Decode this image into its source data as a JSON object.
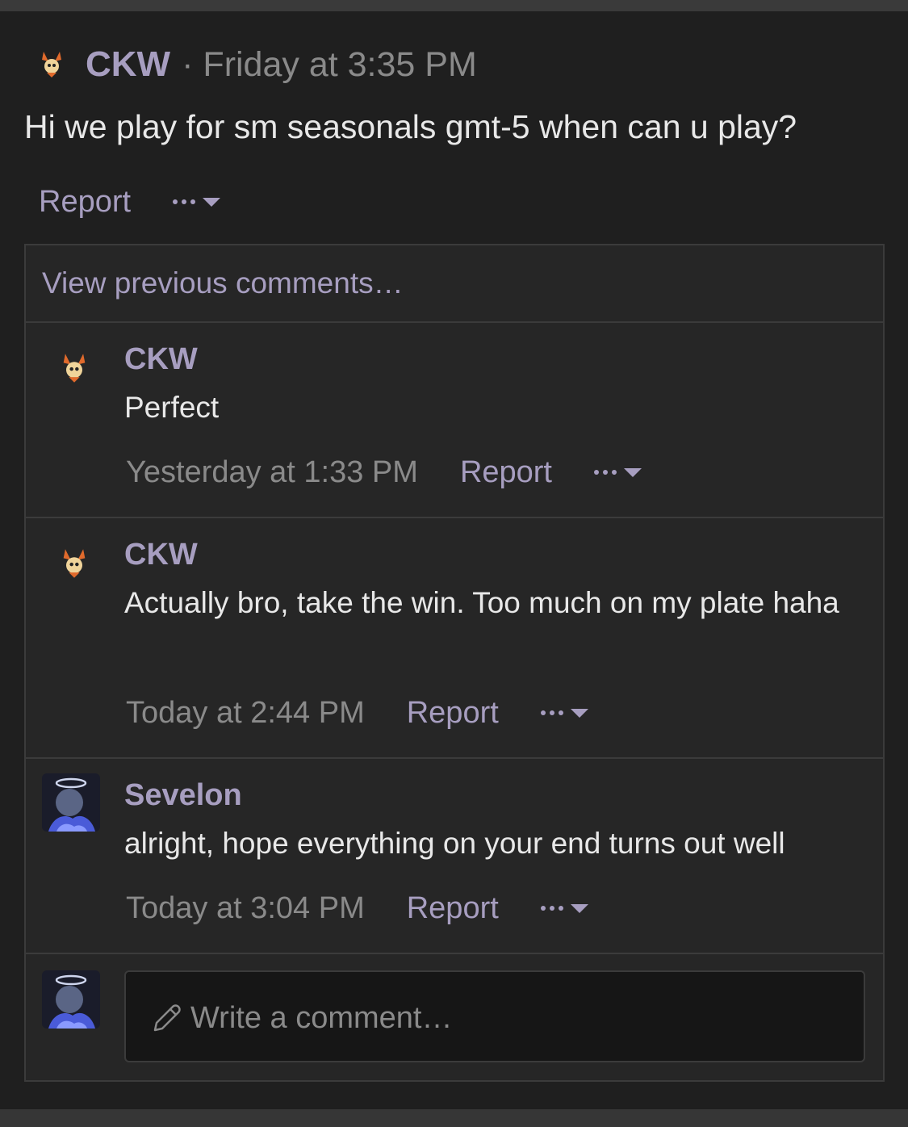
{
  "post": {
    "author": "CKW",
    "separator": "·",
    "time": "Friday at 3:35 PM",
    "body": "Hi we play for sm seasonals gmt-5 when can u play?",
    "report_label": "Report"
  },
  "comments_section": {
    "view_previous_label": "View previous comments…",
    "comments": [
      {
        "author": "CKW",
        "text": "Perfect",
        "time": "Yesterday at 1:33 PM",
        "report_label": "Report"
      },
      {
        "author": "CKW",
        "text": "Actually bro, take the win. Too much on my plate haha",
        "time": "Today at 2:44 PM",
        "report_label": "Report"
      },
      {
        "author": "Sevelon",
        "text": "alright, hope everything on your end turns out well",
        "time": "Today at 3:04 PM",
        "report_label": "Report"
      }
    ],
    "reply_placeholder": "Write a comment…"
  },
  "icons": {
    "ckw_avatar": "orange-fox-sprite-icon",
    "sevelon_avatar": "angel-halo-avatar",
    "more_menu": "more-dots-caret-icon",
    "pencil": "pencil-icon"
  },
  "colors": {
    "accent": "#a79ec0",
    "background": "#1f1f1f",
    "panel": "#262626",
    "text": "#e8e8e8",
    "muted": "#8a8a8a"
  }
}
